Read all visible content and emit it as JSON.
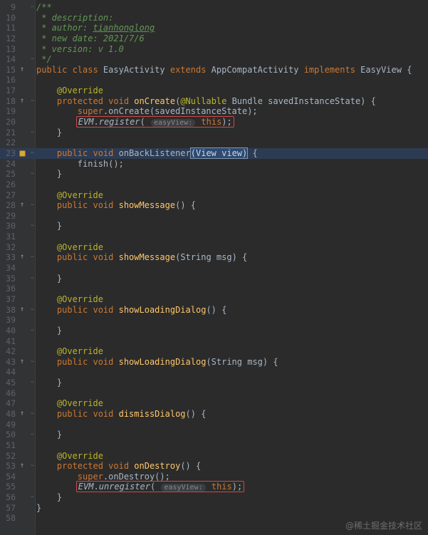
{
  "palette": {
    "editor_bg": "#2b2b2b",
    "gutter_bg": "#313335",
    "gutter_border": "#3c3f41",
    "line_number": "#606366",
    "comment": "#629755",
    "keyword": "#cc7832",
    "annotation": "#bbb529",
    "method": "#ffc66b",
    "plain": "#a9b7c6",
    "hint_text": "#8a8a8a",
    "hint_bg": "#3b3e41",
    "highlight_row": "#2d3b52",
    "selection_bg": "#2e4a71",
    "red_box": "#d04a4a",
    "fold": "#5f6364",
    "icon": "#9a9a9a",
    "bulb": "#d7a93c",
    "watermark": "#6e6e6e"
  },
  "icons": {
    "override_glyph": "↑",
    "fold_start_glyph": "−",
    "fold_end_glyph": "−"
  },
  "watermark": {
    "text": "@稀土掘金技术社区"
  },
  "editor": {
    "lines": [
      {
        "n": 9,
        "fold": "s",
        "segs": [
          [
            "comment",
            "/**"
          ]
        ]
      },
      {
        "n": 10,
        "segs": [
          [
            "comment",
            " * description:"
          ]
        ]
      },
      {
        "n": 11,
        "segs": [
          [
            "comment",
            " * author: "
          ],
          [
            "comment-link",
            "tianhonglong"
          ]
        ]
      },
      {
        "n": 12,
        "segs": [
          [
            "comment",
            " * new date: 2021/7/6"
          ]
        ]
      },
      {
        "n": 13,
        "segs": [
          [
            "comment",
            " * version: v 1.0"
          ]
        ]
      },
      {
        "n": 14,
        "fold": "e",
        "segs": [
          [
            "comment",
            " */"
          ]
        ]
      },
      {
        "n": 15,
        "icon": "override",
        "segs": [
          [
            "keyword",
            "public class "
          ],
          [
            "plain",
            "EasyActivity "
          ],
          [
            "keyword",
            "extends "
          ],
          [
            "plain",
            "AppCompatActivity "
          ],
          [
            "keyword",
            "implements "
          ],
          [
            "plain",
            "EasyView {"
          ]
        ]
      },
      {
        "n": 16,
        "segs": []
      },
      {
        "n": 17,
        "segs": [
          [
            "plain",
            "    "
          ],
          [
            "annotation",
            "@Override"
          ]
        ]
      },
      {
        "n": 18,
        "icon": "override",
        "fold": "s",
        "segs": [
          [
            "plain",
            "    "
          ],
          [
            "keyword",
            "protected void "
          ],
          [
            "method",
            "onCreate"
          ],
          [
            "plain",
            "("
          ],
          [
            "annotation",
            "@Nullable"
          ],
          [
            "plain",
            " Bundle savedInstanceState) {"
          ]
        ]
      },
      {
        "n": 19,
        "segs": [
          [
            "plain",
            "        "
          ],
          [
            "keyword",
            "super"
          ],
          [
            "plain",
            ".onCreate(savedInstanceState);"
          ]
        ]
      },
      {
        "n": 20,
        "segs": [
          [
            "plain",
            "        "
          ]
        ],
        "box": [
          [
            "static",
            "EVM"
          ],
          [
            "plain",
            "."
          ],
          [
            "static",
            "register"
          ],
          [
            "plain",
            "( "
          ],
          [
            "hint",
            "easyView:"
          ],
          [
            "plain",
            " "
          ],
          [
            "keyword",
            "this"
          ],
          [
            "plain",
            ");"
          ]
        ]
      },
      {
        "n": 21,
        "fold": "e",
        "segs": [
          [
            "plain",
            "    }"
          ]
        ]
      },
      {
        "n": 22,
        "segs": []
      },
      {
        "n": 23,
        "icon": "bulb",
        "fold": "s",
        "hl": true,
        "segs": [
          [
            "plain",
            "    "
          ],
          [
            "keyword",
            "public void "
          ],
          [
            "plain",
            "onBackListener"
          ],
          [
            "selection",
            "(View view)"
          ],
          [
            "plain",
            " {"
          ]
        ]
      },
      {
        "n": 24,
        "segs": [
          [
            "plain",
            "        finish();"
          ]
        ]
      },
      {
        "n": 25,
        "fold": "e",
        "segs": [
          [
            "plain",
            "    }"
          ]
        ]
      },
      {
        "n": 26,
        "segs": []
      },
      {
        "n": 27,
        "segs": [
          [
            "plain",
            "    "
          ],
          [
            "annotation",
            "@Override"
          ]
        ]
      },
      {
        "n": 28,
        "icon": "override",
        "fold": "s",
        "segs": [
          [
            "plain",
            "    "
          ],
          [
            "keyword",
            "public void "
          ],
          [
            "method",
            "showMessage"
          ],
          [
            "plain",
            "() {"
          ]
        ]
      },
      {
        "n": 29,
        "segs": []
      },
      {
        "n": 30,
        "fold": "e",
        "segs": [
          [
            "plain",
            "    }"
          ]
        ]
      },
      {
        "n": 31,
        "segs": []
      },
      {
        "n": 32,
        "segs": [
          [
            "plain",
            "    "
          ],
          [
            "annotation",
            "@Override"
          ]
        ]
      },
      {
        "n": 33,
        "icon": "override",
        "fold": "s",
        "segs": [
          [
            "plain",
            "    "
          ],
          [
            "keyword",
            "public void "
          ],
          [
            "method",
            "showMessage"
          ],
          [
            "plain",
            "(String msg) {"
          ]
        ]
      },
      {
        "n": 34,
        "segs": []
      },
      {
        "n": 35,
        "fold": "e",
        "segs": [
          [
            "plain",
            "    }"
          ]
        ]
      },
      {
        "n": 36,
        "segs": []
      },
      {
        "n": 37,
        "segs": [
          [
            "plain",
            "    "
          ],
          [
            "annotation",
            "@Override"
          ]
        ]
      },
      {
        "n": 38,
        "icon": "override",
        "fold": "s",
        "segs": [
          [
            "plain",
            "    "
          ],
          [
            "keyword",
            "public void "
          ],
          [
            "method",
            "showLoadingDialog"
          ],
          [
            "plain",
            "() {"
          ]
        ]
      },
      {
        "n": 39,
        "segs": []
      },
      {
        "n": 40,
        "fold": "e",
        "segs": [
          [
            "plain",
            "    }"
          ]
        ]
      },
      {
        "n": 41,
        "segs": []
      },
      {
        "n": 42,
        "segs": [
          [
            "plain",
            "    "
          ],
          [
            "annotation",
            "@Override"
          ]
        ]
      },
      {
        "n": 43,
        "icon": "override",
        "fold": "s",
        "segs": [
          [
            "plain",
            "    "
          ],
          [
            "keyword",
            "public void "
          ],
          [
            "method",
            "showLoadingDialog"
          ],
          [
            "plain",
            "(String msg) {"
          ]
        ]
      },
      {
        "n": 44,
        "segs": []
      },
      {
        "n": 45,
        "fold": "e",
        "segs": [
          [
            "plain",
            "    }"
          ]
        ]
      },
      {
        "n": 46,
        "segs": []
      },
      {
        "n": 47,
        "segs": [
          [
            "plain",
            "    "
          ],
          [
            "annotation",
            "@Override"
          ]
        ]
      },
      {
        "n": 48,
        "icon": "override",
        "fold": "s",
        "segs": [
          [
            "plain",
            "    "
          ],
          [
            "keyword",
            "public void "
          ],
          [
            "method",
            "dismissDialog"
          ],
          [
            "plain",
            "() {"
          ]
        ]
      },
      {
        "n": 49,
        "segs": []
      },
      {
        "n": 50,
        "fold": "e",
        "segs": [
          [
            "plain",
            "    }"
          ]
        ]
      },
      {
        "n": 51,
        "segs": []
      },
      {
        "n": 52,
        "segs": [
          [
            "plain",
            "    "
          ],
          [
            "annotation",
            "@Override"
          ]
        ]
      },
      {
        "n": 53,
        "icon": "override",
        "fold": "s",
        "segs": [
          [
            "plain",
            "    "
          ],
          [
            "keyword",
            "protected void "
          ],
          [
            "method",
            "onDestroy"
          ],
          [
            "plain",
            "() {"
          ]
        ]
      },
      {
        "n": 54,
        "segs": [
          [
            "plain",
            "        "
          ],
          [
            "keyword",
            "super"
          ],
          [
            "plain",
            ".onDestroy();"
          ]
        ]
      },
      {
        "n": 55,
        "segs": [
          [
            "plain",
            "        "
          ]
        ],
        "box": [
          [
            "static",
            "EVM"
          ],
          [
            "plain",
            "."
          ],
          [
            "static",
            "unregister"
          ],
          [
            "plain",
            "( "
          ],
          [
            "hint",
            "easyView:"
          ],
          [
            "plain",
            " "
          ],
          [
            "keyword",
            "this"
          ],
          [
            "plain",
            ");"
          ]
        ]
      },
      {
        "n": 56,
        "fold": "e",
        "segs": [
          [
            "plain",
            "    }"
          ]
        ]
      },
      {
        "n": 57,
        "segs": [
          [
            "plain",
            "}"
          ]
        ]
      },
      {
        "n": 58,
        "segs": []
      }
    ]
  }
}
